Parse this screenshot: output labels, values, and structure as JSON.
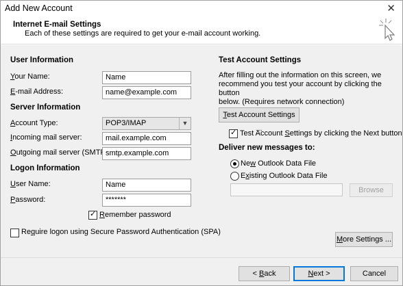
{
  "window": {
    "title": "Add New Account",
    "close_glyph": "✕"
  },
  "header": {
    "title": "Internet E-mail Settings",
    "subtitle": "Each of these settings are required to get your e-mail account working."
  },
  "user_info": {
    "section": "User Information",
    "name_label": "Your Name:",
    "name_label_ul": "Y",
    "name_label_rest": "our Name:",
    "name_value": "Name",
    "email_label_ul": "E",
    "email_label_rest": "-mail Address:",
    "email_value": "name@example.com"
  },
  "server_info": {
    "section": "Server Information",
    "account_type_ul": "A",
    "account_type_rest": "ccount Type:",
    "account_type_value": "POP3/IMAP",
    "incoming_ul": "I",
    "incoming_rest": "ncoming mail server:",
    "incoming_value": "mail.example.com",
    "outgoing_ul": "O",
    "outgoing_rest": "utgoing mail server (SMTP):",
    "outgoing_value": "smtp.example.com"
  },
  "logon_info": {
    "section": "Logon Information",
    "user_ul": "U",
    "user_rest": "ser Name:",
    "user_value": "Name",
    "password_ul": "P",
    "password_rest": "assword:",
    "password_value": "*******",
    "remember_ul": "R",
    "remember_rest": "emember password",
    "remember_checked": "✓",
    "spa_ul": "q",
    "spa_pre": "Re",
    "spa_rest": "uire logon using Secure Password Authentication (SPA)"
  },
  "test_settings": {
    "section": "Test Account Settings",
    "para_line1": "After filling out the information on this screen, we",
    "para_line2": "recommend you test your account by clicking the button",
    "para_line3": "below. (Requires network connection)",
    "test_button_ul": "T",
    "test_button_rest": "est Account Settings ...",
    "next_check_checked": "✓",
    "next_check_pre": "Test Account ",
    "next_check_ul": "S",
    "next_check_rest": "ettings by clicking the Next button"
  },
  "deliver": {
    "section": "Deliver new messages to:",
    "new_pre": "Ne",
    "new_ul": "w",
    "new_rest": " Outlook Data File",
    "existing_pre": "E",
    "existing_ul": "x",
    "existing_rest": "isting Outlook Data File",
    "existing_path": "",
    "browse_label": "Browse"
  },
  "more_settings": {
    "ul": "M",
    "rest": "ore Settings ..."
  },
  "footer": {
    "back_pre": "< ",
    "back_ul": "B",
    "back_rest": "ack",
    "next_ul": "N",
    "next_rest": "ext >",
    "cancel": "Cancel"
  }
}
